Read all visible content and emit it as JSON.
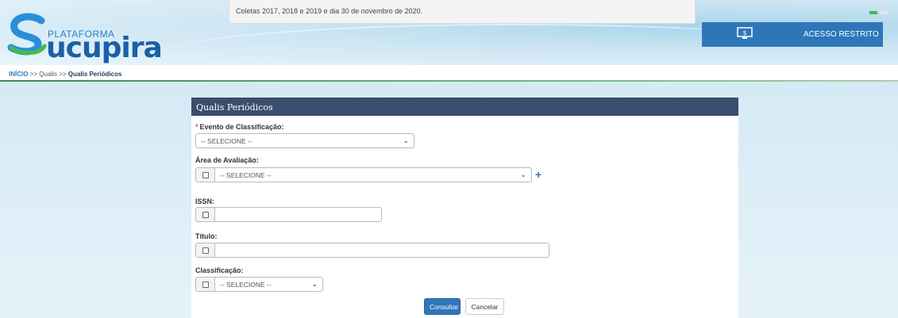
{
  "header": {
    "logo_small": "PLATAFORMA",
    "logo_big": "ucupira",
    "notice": "Coletas 2017, 2018 e 2019 e dia 30 de novembro de 2020.",
    "restricted_access": "ACESSO RESTRITO"
  },
  "breadcrumb": {
    "home": "INÍCIO",
    "sep1": ">>",
    "item1": "Qualis",
    "sep2": ">>",
    "current": "Qualis Periódicos"
  },
  "form": {
    "title": "Qualis Periódicos",
    "evento": {
      "required_mark": "*",
      "label": "Evento de Classificação:",
      "value": "-- SELECIONE --"
    },
    "area": {
      "label": "Área de Avaliação:",
      "value": "-- SELECIONE --"
    },
    "issn": {
      "label": "ISSN:",
      "value": ""
    },
    "titulo": {
      "label": "Título:",
      "value": ""
    },
    "classificacao": {
      "label": "Classificação:",
      "value": "-- SELECIONE --"
    },
    "submit_label": "Consultar",
    "cancel_label": "Cancelar"
  },
  "colors": {
    "panel_header": "#3a4d6c",
    "primary": "#2f76b9",
    "accent_green": "#3a8b4a"
  },
  "icons": [
    "logo-s-icon",
    "monitor-icon",
    "plus-icon",
    "chevron-down-icon"
  ]
}
